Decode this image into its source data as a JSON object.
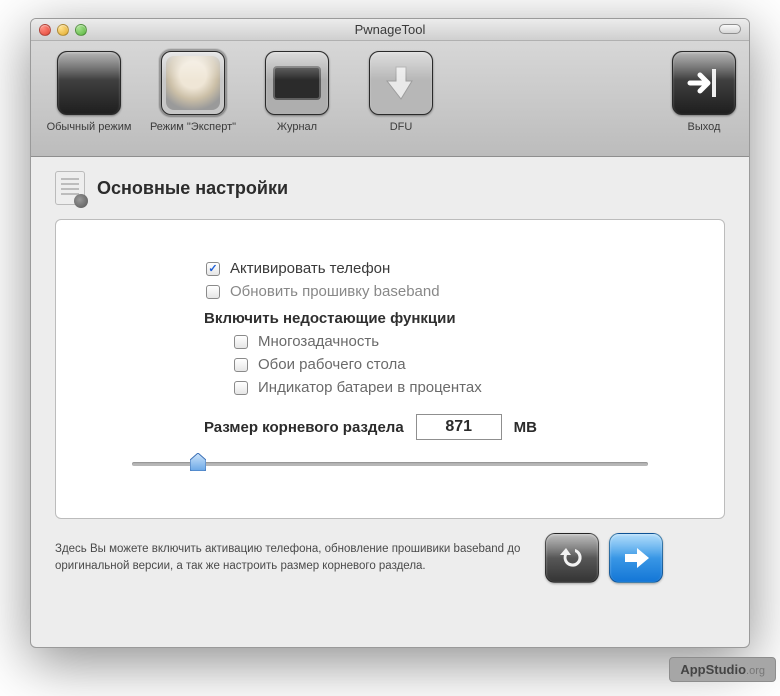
{
  "window": {
    "title": "PwnageTool"
  },
  "toolbar": {
    "items": [
      {
        "key": "simple",
        "label": "Обычный режим"
      },
      {
        "key": "expert",
        "label": "Режим \"Эксперт\""
      },
      {
        "key": "journal",
        "label": "Журнал"
      },
      {
        "key": "dfu",
        "label": "DFU"
      }
    ],
    "exit_label": "Выход",
    "selected_key": "expert"
  },
  "section": {
    "title": "Основные настройки"
  },
  "options": {
    "activate": {
      "label": "Активировать телефон",
      "checked": true
    },
    "baseband": {
      "label": "Обновить прошивку baseband",
      "checked": false
    },
    "missing_heading": "Включить недостающие функции",
    "multitask": {
      "label": "Многозадачность",
      "checked": false
    },
    "wallpaper": {
      "label": "Обои рабочего стола",
      "checked": false
    },
    "battery": {
      "label": "Индикатор батареи в процентах",
      "checked": false
    }
  },
  "partition": {
    "label": "Размер корневого раздела",
    "value": "871",
    "unit": "MB",
    "slider_percent": 11
  },
  "footer": {
    "help": "Здесь Вы можете включить активацию телефона, обновление прошивики baseband до оригинальной версии, а так же настроить размер корневого раздела."
  },
  "watermark": {
    "brand": "AppStudio",
    "suffix": ".org"
  }
}
